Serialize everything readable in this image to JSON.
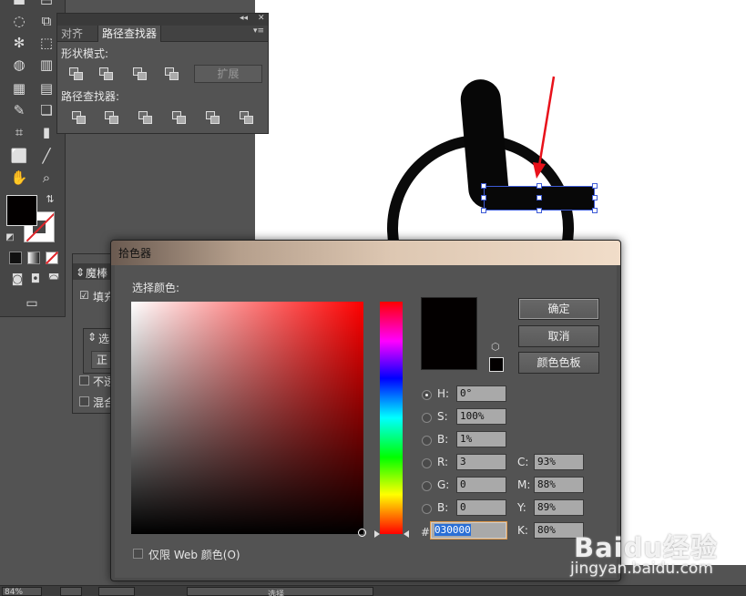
{
  "pathfinder_panel": {
    "tabs": [
      "对齐",
      "路径查找器"
    ],
    "shape_modes_label": "形状模式:",
    "pathfinders_label": "路径查找器:",
    "expand_label": "扩展"
  },
  "magic_wand_panel": {
    "title": "魔棒",
    "fill_label": "填充",
    "opacity_label": "不透",
    "blend_label": "混合",
    "sub_label1": "选",
    "sub_label2": "正"
  },
  "color_picker": {
    "title": "拾色器",
    "select_color_label": "选择颜色:",
    "buttons": {
      "ok": "确定",
      "cancel": "取消",
      "swatches": "颜色色板"
    },
    "hsb": {
      "h_label": "H:",
      "h_value": "0°",
      "s_label": "S:",
      "s_value": "100%",
      "b_label": "B:",
      "b_value": "1%"
    },
    "rgb": {
      "r_label": "R:",
      "r_value": "3",
      "g_label": "G:",
      "g_value": "0",
      "b_label": "B:",
      "b_value": "0"
    },
    "cmyk": {
      "c_label": "C:",
      "c_value": "93%",
      "m_label": "M:",
      "m_value": "88%",
      "y_label": "Y:",
      "y_value": "89%",
      "k_label": "K:",
      "k_value": "80%"
    },
    "hex_label": "#",
    "hex_value": "030000",
    "web_only_label": "仅限 Web 颜色(O)",
    "current_color": "#030000"
  },
  "status_bar": {
    "zoom": "84%",
    "tool_label": "选择"
  },
  "watermark": {
    "logo": "Baidu经验",
    "url": "jingyan.baidu.com"
  },
  "colors": {
    "selection_accent": "#3d5bd6",
    "arrow": "#e8111a",
    "hex_highlight": "#2a6fd6"
  }
}
